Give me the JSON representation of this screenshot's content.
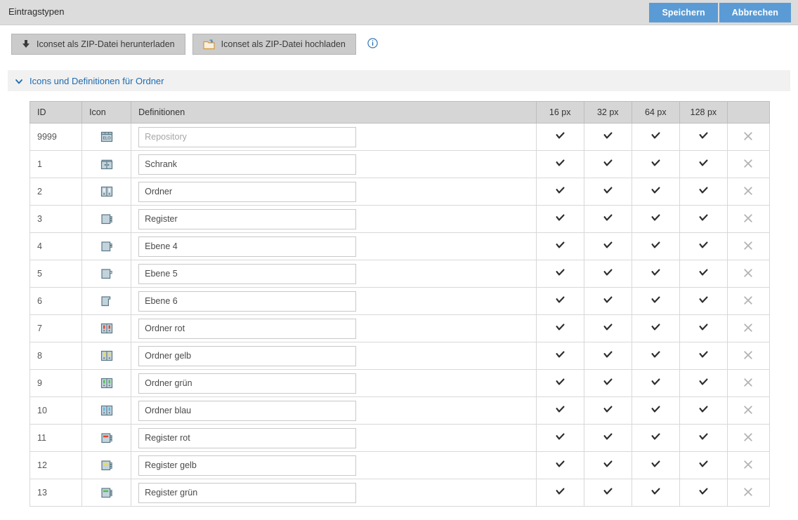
{
  "window": {
    "title": "Eintragstypen",
    "save_label": "Speichern",
    "cancel_label": "Abbrechen"
  },
  "toolbar": {
    "download_label": "Iconset als ZIP-Datei herunterladen",
    "upload_label": "Iconset als ZIP-Datei hochladen",
    "download_icon": "download-arrow-icon",
    "upload_icon": "upload-folder-icon",
    "info_icon": "info-circle-icon"
  },
  "section": {
    "title": "Icons und Definitionen für Ordner",
    "chevron_icon": "chevron-down-icon",
    "expanded": true
  },
  "table": {
    "headers": {
      "id": "ID",
      "icon": "Icon",
      "definitions": "Definitionen",
      "px16": "16 px",
      "px32": "32 px",
      "px64": "64 px",
      "px128": "128 px",
      "delete": ""
    },
    "check_icon": "checkmark-icon",
    "delete_icon": "close-x-icon",
    "rows": [
      {
        "id": "9999",
        "icon": "elo-repository-icon",
        "value": "",
        "placeholder": "Repository",
        "px16": true,
        "px32": true,
        "px64": true,
        "px128": true
      },
      {
        "id": "1",
        "icon": "cabinet-icon",
        "value": "Schrank",
        "placeholder": "",
        "px16": true,
        "px32": true,
        "px64": true,
        "px128": true
      },
      {
        "id": "2",
        "icon": "binder-icon",
        "value": "Ordner",
        "placeholder": "",
        "px16": true,
        "px32": true,
        "px64": true,
        "px128": true
      },
      {
        "id": "3",
        "icon": "register-icon",
        "value": "Register",
        "placeholder": "",
        "px16": true,
        "px32": true,
        "px64": true,
        "px128": true
      },
      {
        "id": "4",
        "icon": "level4-icon",
        "value": "Ebene 4",
        "placeholder": "",
        "px16": true,
        "px32": true,
        "px64": true,
        "px128": true
      },
      {
        "id": "5",
        "icon": "level5-icon",
        "value": "Ebene 5",
        "placeholder": "",
        "px16": true,
        "px32": true,
        "px64": true,
        "px128": true
      },
      {
        "id": "6",
        "icon": "level6-icon",
        "value": "Ebene 6",
        "placeholder": "",
        "px16": true,
        "px32": true,
        "px64": true,
        "px128": true
      },
      {
        "id": "7",
        "icon": "binder-red-icon",
        "value": "Ordner rot",
        "placeholder": "",
        "px16": true,
        "px32": true,
        "px64": true,
        "px128": true
      },
      {
        "id": "8",
        "icon": "binder-yellow-icon",
        "value": "Ordner gelb",
        "placeholder": "",
        "px16": true,
        "px32": true,
        "px64": true,
        "px128": true
      },
      {
        "id": "9",
        "icon": "binder-green-icon",
        "value": "Ordner grün",
        "placeholder": "",
        "px16": true,
        "px32": true,
        "px64": true,
        "px128": true
      },
      {
        "id": "10",
        "icon": "binder-blue-icon",
        "value": "Ordner blau",
        "placeholder": "",
        "px16": true,
        "px32": true,
        "px64": true,
        "px128": true
      },
      {
        "id": "11",
        "icon": "register-red-icon",
        "value": "Register rot",
        "placeholder": "",
        "px16": true,
        "px32": true,
        "px64": true,
        "px128": true
      },
      {
        "id": "12",
        "icon": "register-yellow-icon",
        "value": "Register gelb",
        "placeholder": "",
        "px16": true,
        "px32": true,
        "px64": true,
        "px128": true
      },
      {
        "id": "13",
        "icon": "register-green-icon",
        "value": "Register grün",
        "placeholder": "",
        "px16": true,
        "px32": true,
        "px64": true,
        "px128": true
      }
    ]
  },
  "colors": {
    "accent_blue": "#5b9bd5",
    "link_blue": "#1f6bb0",
    "titlebar_gray": "#dcdcdc",
    "button_gray": "#cbcbcb",
    "header_gray": "#d6d6d6",
    "section_gray": "#f1f1f1",
    "icon_body": "#c3d3dc",
    "icon_outline": "#5a7785",
    "label_red": "#e8432b",
    "label_yellow": "#f5dd3f",
    "label_green": "#4ec04e",
    "label_blue": "#5bb8e8"
  }
}
